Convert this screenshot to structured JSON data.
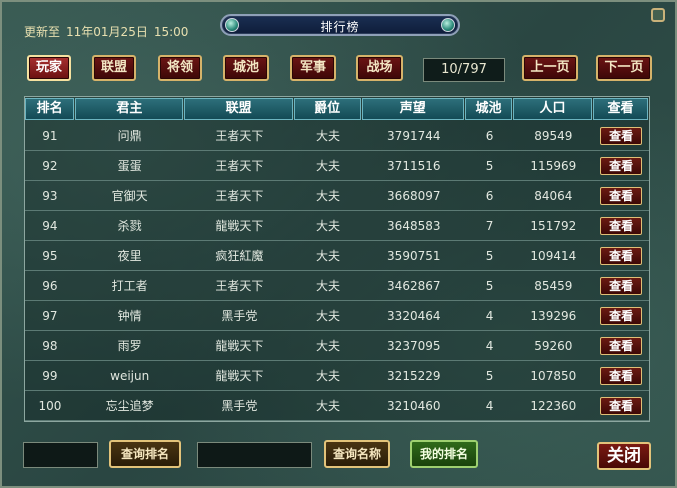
{
  "update": {
    "prefix": "更新至",
    "date": "11年01月25日",
    "time": "15:00"
  },
  "title": "排行榜",
  "tabs": [
    {
      "label": "玩家",
      "active": true
    },
    {
      "label": "联盟",
      "active": false
    },
    {
      "label": "将领",
      "active": false
    },
    {
      "label": "城池",
      "active": false
    },
    {
      "label": "军事",
      "active": false
    },
    {
      "label": "战场",
      "active": false
    }
  ],
  "pagination": {
    "current": "10/797",
    "prev_label": "上一页",
    "next_label": "下一页"
  },
  "table": {
    "headers": [
      "排名",
      "君主",
      "联盟",
      "爵位",
      "声望",
      "城池",
      "人口",
      "查看"
    ],
    "view_label": "查看",
    "rows": [
      [
        "91",
        "问鼎",
        "王者天下",
        "大夫",
        "3791744",
        "6",
        "89549"
      ],
      [
        "92",
        "蛋蛋",
        "王者天下",
        "大夫",
        "3711516",
        "5",
        "115969"
      ],
      [
        "93",
        "官御天",
        "王者天下",
        "大夫",
        "3668097",
        "6",
        "84064"
      ],
      [
        "94",
        "杀戮",
        "龍戦天下",
        "大夫",
        "3648583",
        "7",
        "151792"
      ],
      [
        "95",
        "夜里",
        "疯狂紅魔",
        "大夫",
        "3590751",
        "5",
        "109414"
      ],
      [
        "96",
        "打工者",
        "王者天下",
        "大夫",
        "3462867",
        "5",
        "85459"
      ],
      [
        "97",
        "钟情",
        "黑手党",
        "大夫",
        "3320464",
        "4",
        "139296"
      ],
      [
        "98",
        "雨罗",
        "龍戦天下",
        "大夫",
        "3237095",
        "4",
        "59260"
      ],
      [
        "99",
        "weijun",
        "龍戦天下",
        "大夫",
        "3215229",
        "5",
        "107850"
      ],
      [
        "100",
        "忘尘追梦",
        "黑手党",
        "大夫",
        "3210460",
        "4",
        "122360"
      ]
    ]
  },
  "bottom": {
    "search_rank_label": "查询排名",
    "search_name_label": "查询名称",
    "my_rank_label": "我的排名",
    "close_label": "关闭"
  }
}
